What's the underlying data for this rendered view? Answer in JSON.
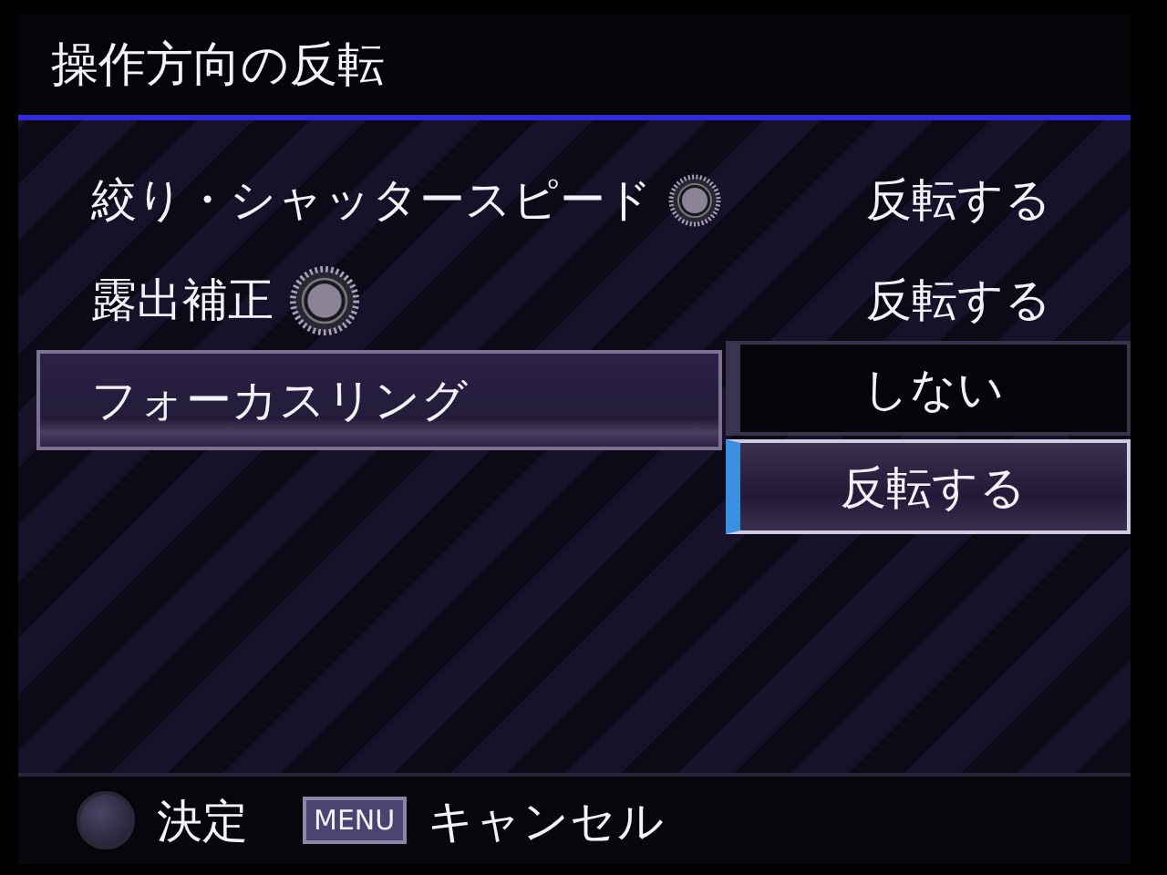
{
  "title": "操作方向の反転",
  "items": [
    {
      "label": "絞り・シャッタースピード",
      "dial": true,
      "value": "反転する",
      "selected": false
    },
    {
      "label": "露出補正",
      "dial": true,
      "value": "反転する",
      "selected": false
    },
    {
      "label": "フォーカスリング",
      "dial": false,
      "selected": true
    }
  ],
  "dropdown": [
    {
      "label": "しない",
      "selected": false
    },
    {
      "label": "反転する",
      "selected": true
    }
  ],
  "footer": [
    {
      "kind": "button",
      "label": "決定"
    },
    {
      "kind": "key",
      "key": "MENU",
      "label": "キャンセル"
    }
  ]
}
